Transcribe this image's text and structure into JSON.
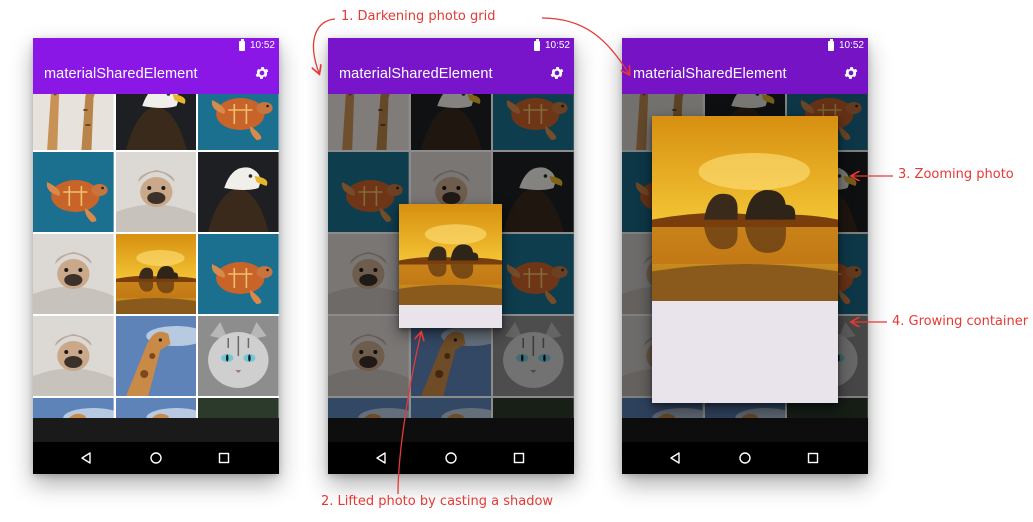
{
  "phones": [
    {
      "status_time": "10:52",
      "app_title": "materialSharedElement",
      "toolbar_color": "#8a17e6",
      "scrim": 0
    },
    {
      "status_time": "10:52",
      "app_title": "materialSharedElement",
      "toolbar_color": "#8a17e6",
      "scrim": 0.45
    },
    {
      "status_time": "10:52",
      "app_title": "materialSharedElement",
      "toolbar_color": "#8a17e6",
      "scrim": 0.5
    }
  ],
  "grid_photos": [
    "giraffes",
    "eagle",
    "turtle",
    "turtle",
    "pug",
    "eagle",
    "pug",
    "elephants",
    "turtle",
    "pug",
    "giraffe",
    "cat",
    "giraffe",
    "giraffe",
    "hawk"
  ],
  "icons": {
    "settings": "gear-icon",
    "back": "back-triangle-icon",
    "home": "home-circle-icon",
    "recents": "recents-square-icon",
    "battery": "battery-icon"
  },
  "annotations": {
    "step1": "1. Darkening photo grid",
    "step2": "2. Lifted photo by casting a shadow",
    "step3": "3. Zooming photo",
    "step4": "4. Growing container"
  },
  "colors": {
    "accent": "#8a17e6",
    "annotation": "#e53935",
    "container": "#e9e4ec"
  }
}
